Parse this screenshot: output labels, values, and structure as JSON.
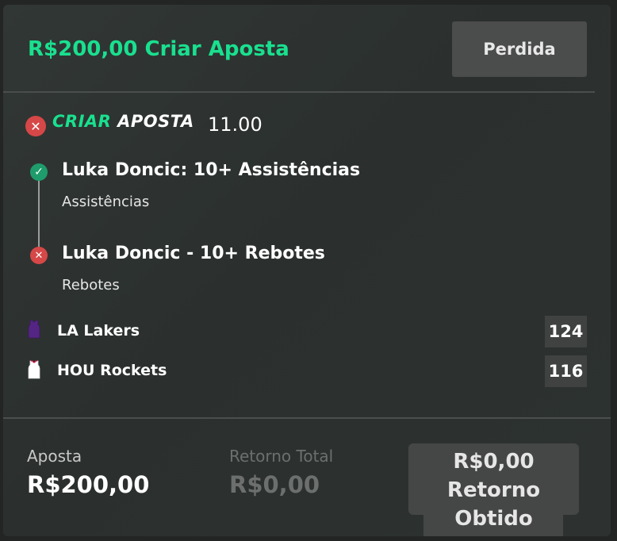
{
  "header": {
    "title": "R$200,00 Criar Aposta",
    "status": "Perdida"
  },
  "bet": {
    "logo_part1": "CRIAR",
    "logo_part2": "APOSTA",
    "odds": "11.00",
    "selections": [
      {
        "title": "Luka Doncic: 10+ Assistências",
        "market": "Assistências",
        "result": "won"
      },
      {
        "title": "Luka Doncic - 10+ Rebotes",
        "market": "Rebotes",
        "result": "lost"
      }
    ]
  },
  "teams": [
    {
      "name": "LA Lakers",
      "score": "124",
      "jersey_color": "#552583"
    },
    {
      "name": "HOU Rockets",
      "score": "116",
      "jersey_color": "#ffffff"
    }
  ],
  "footer": {
    "stake_label": "Aposta",
    "stake_value": "R$200,00",
    "total_return_label": "Retorno Total",
    "total_return_value": "R$0,00",
    "returned_line1": "R$0,00",
    "returned_line2": "Retorno",
    "returned_line3": "Obtido"
  },
  "colors": {
    "accent": "#19e08f",
    "lost": "#d64747",
    "won": "#1f9c6b"
  }
}
